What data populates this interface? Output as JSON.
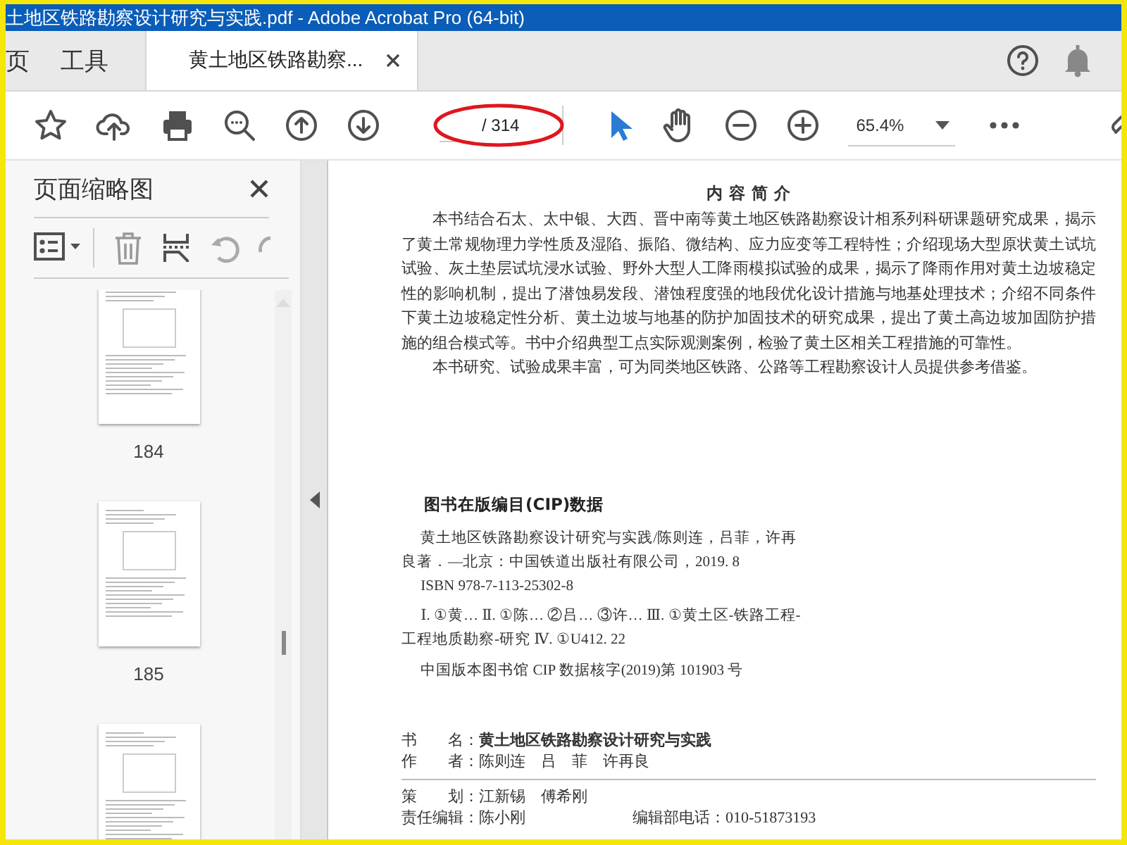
{
  "window": {
    "title": "土地区铁路勘察设计研究与实践.pdf - Adobe Acrobat Pro (64-bit)"
  },
  "tabs": [
    {
      "label": "页",
      "selected": false
    },
    {
      "label": "工具",
      "selected": false
    },
    {
      "label": "黄土地区铁路勘察...",
      "selected": true
    }
  ],
  "toolbar": {
    "page_total": "/ 314",
    "zoom": "65.4%"
  },
  "thumbnails_panel": {
    "title": "页面缩略图",
    "pages": [
      {
        "label": "184",
        "kind": "figure"
      },
      {
        "label": "185",
        "kind": "figure"
      },
      {
        "kind": "figure"
      }
    ]
  },
  "document": {
    "heading": "内 容 简 介",
    "paragraphs": [
      "本书结合石太、太中银、大西、晋中南等黄土地区铁路勘察设计相系列科研课题研究成果，揭示了黄土常规物理力学性质及湿陷、振陷、微结构、应力应变等工程特性；介绍现场大型原状黄土试坑试验、灰土垫层试坑浸水试验、野外大型人工降雨模拟试验的成果，揭示了降雨作用对黄土边坡稳定性的影响机制，提出了潜蚀易发段、潜蚀程度强的地段优化设计措施与地基处理技术；介绍不同条件下黄土边坡稳定性分析、黄土边坡与地基的防护加固技术的研究成果，提出了黄土高边坡加固防护措施的组合模式等。书中介绍典型工点实际观测案例，检验了黄土区相关工程措施的可靠性。",
      "本书研究、试验成果丰富，可为同类地区铁路、公路等工程勘察设计人员提供参考借鉴。"
    ],
    "cip_title": "图书在版编目(CIP)数据",
    "cip_lines": [
      "黄土地区铁路勘察设计研究与实践/陈则连，吕菲，许再良著．—北京：中国铁道出版社有限公司，2019. 8",
      "ISBN 978-7-113-25302-8",
      "Ⅰ. ①黄… Ⅱ. ①陈… ②吕… ③许… Ⅲ. ①黄土区-铁路工程-工程地质勘察-研究 Ⅳ. ①U412. 22",
      "中国版本图书馆 CIP 数据核字(2019)第 101903 号"
    ],
    "colophon_top": [
      "书　　名：**黄土地区铁路勘察设计研究与实践**",
      "作　　者：陈则连　吕　菲　许再良"
    ],
    "colophon_bottom": [
      [
        "策　　划：江新锡　傅希刚"
      ],
      [
        "责任编辑：陈小刚",
        "编辑部电话：010-51873193"
      ]
    ]
  }
}
